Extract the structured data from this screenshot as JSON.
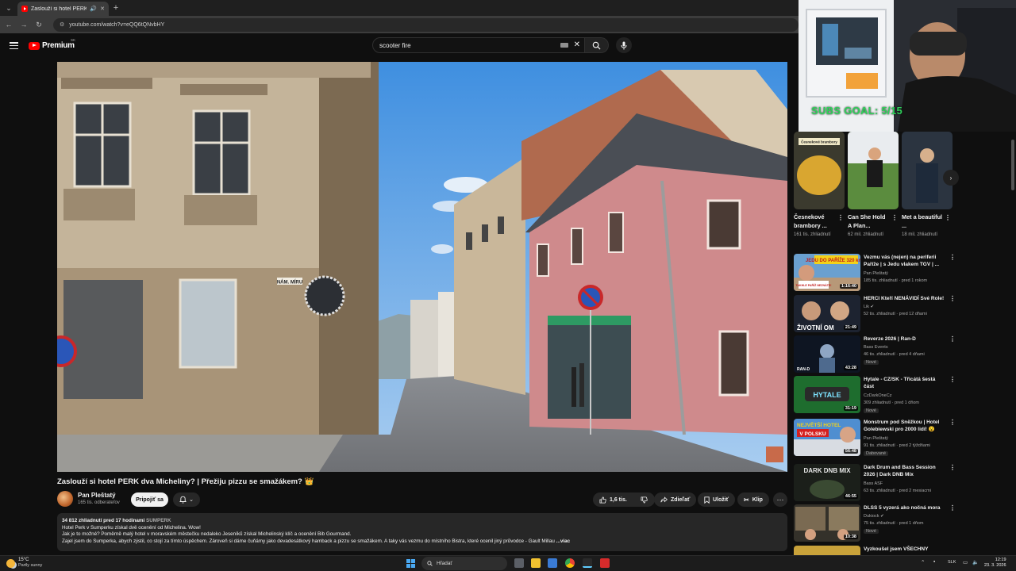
{
  "browser": {
    "tab_title": "Zaslouží si hotel PERK dva Mi",
    "url": "youtube.com/watch?v=eQQ6tQNvbHY"
  },
  "youtube": {
    "logo_text": "Premium",
    "country_code": "SK",
    "search_value": "scooter fire"
  },
  "video": {
    "title": "Zaslouží si hotel PERK dva Micheliny? | Přežiju pizzu se smažákem? 👑",
    "channel_name": "Pan Pleštatý",
    "channel_subs": "165 tis. odberateľov",
    "join_label": "Pripojiť sa",
    "like_count": "1,6 tis.",
    "share_label": "Zdieľať",
    "save_label": "Uložiť",
    "clip_label": "Klip",
    "sign_text": "NÁM. MÍRU",
    "meta": "34 812 zhliadnutí  pred 17 hodinami",
    "meta_tag": "ŠUMPERK",
    "desc_line1": "Hotel Perk v Šumperku získal dvě ocenění od Michelina. Wow!",
    "desc_line2": "Jak je to možné? Poměrně malý hotel v moravském městečku nedaleko Jeseníků získal Michelinský klíč a ocenění Bib Gourmand.",
    "desc_line3": "Zajel jsem do Šumperka, abych zjistil, co stojí za tímto úspěchem. Zároveň si dáme čuňámy jako devadesátkový hamback a pizzu se smažákem. A taky vás vezmu do místního Bistra, které ocenil jiný průvodce - Gault Millau",
    "desc_more": "...viac"
  },
  "overlay": {
    "subs_goal": "SUBS GOAL: 5/15"
  },
  "shorts": [
    {
      "title": "Česnekové brambory ...",
      "views": "161 tis. zhliadnutí",
      "thumb_text": "Česnekové brambory"
    },
    {
      "title": "Can She Hold A Plan...",
      "views": "62 mil. zhliadnutí"
    },
    {
      "title": "Met a beautiful ...",
      "views": "18 mil. zhliadnutí"
    }
  ],
  "recommended": [
    {
      "title": "Vezmu vás (nejen) na periferii Paříže | s Jedu vlakem TGV | ...",
      "channel": "Pan Pleštatý",
      "meta": "185 tis. zhliadnutí · pred 1 rokom",
      "duration": "1:16:40",
      "thumb_text": "JEDU DO PAŘÍŽE 320 km/h",
      "thumb_text2": "TAKHLE PAŘÍŽ NEZNÁTE!"
    },
    {
      "title": "HERCI Kteří NENÁVIDÍ Své Role!",
      "channel": "Lik ✔",
      "meta": "52 tis. zhliadnutí · pred 12 dňami",
      "duration": "21:49",
      "thumb_text": "ŽIVOTNÍ OM"
    },
    {
      "title": "Reverze 2026 | Ran-D",
      "channel": "Bass Events",
      "meta": "46 tis. zhliadnutí · pred 4 dňami",
      "duration": "43:28",
      "badge": "Nové",
      "thumb_text": "RAN-D"
    },
    {
      "title": "Hytale - CZ/SK - Třicátá šestá část",
      "channel": "CzDarkOneCz",
      "meta": "309 zhliadnutí · pred 1 dňom",
      "duration": "31:19",
      "badge": "Nové",
      "thumb_text": "HYTALE"
    },
    {
      "title": "Monstrum pod Sněžkou | Hotel Golebiewski pro 2000 lidí! 😮",
      "channel": "Pan Pleštatý",
      "meta": "91 tis. zhliadnutí · pred 2 týždňami",
      "duration": "56:48",
      "badge": "Dabované",
      "thumb_text": "NEJVĚTŠÍ HOTEL",
      "thumb_text2": "V POLSKU"
    },
    {
      "title": "Dark Drum and Bass Session 2026 | Dark DNB Mix",
      "channel": "Bass ASF",
      "meta": "63 tis. zhliadnutí · pred 2 mesiacmi",
      "duration": "46:55",
      "thumb_text": "DARK DNB MIX"
    },
    {
      "title": "DLSS 5 vyzerá ako nočná mora",
      "channel": "Dukiock ✔",
      "meta": "75 tis. zhliadnutí · pred 1 dňom",
      "duration": "10:38",
      "badge": "Nové"
    },
    {
      "title": "Vyzkoušel jsem VŠECHNY"
    }
  ],
  "taskbar": {
    "temp": "15°C",
    "weather": "Partly sunny",
    "search_placeholder": "Hľadať",
    "lang": "SLK",
    "time": "12:19",
    "date": "23. 3. 2026"
  }
}
